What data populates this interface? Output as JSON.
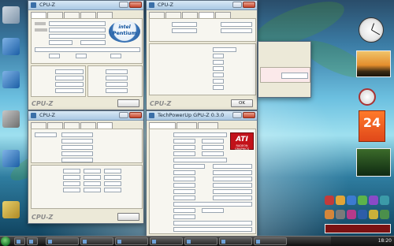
{
  "desktop": {
    "icons": [
      {
        "name": "computer-icon"
      },
      {
        "name": "recycle-bin-icon"
      },
      {
        "name": "internet-explorer-icon"
      },
      {
        "name": "network-icon"
      },
      {
        "name": "control-panel-icon"
      },
      {
        "name": "folder-icon"
      }
    ]
  },
  "windows": {
    "cpuz_cpu": {
      "title": "CPU-Z",
      "logo": "CPU-Z",
      "brand_top": "intel",
      "brand_bottom": "Pentium"
    },
    "cpuz_memory": {
      "title": "CPU-Z",
      "logo": "CPU-Z",
      "ok": "OK"
    },
    "cpuz_spd": {
      "title": "CPU-Z",
      "logo": "CPU-Z"
    },
    "gpuz": {
      "title": "TechPowerUp GPU-Z 0.3.0",
      "brand": "ATI",
      "brand_sub": "RADEON GRAPHICS"
    }
  },
  "gadgets": {
    "calendar_day": "24",
    "icons": [
      "clock-gadget",
      "slideshow-gadget",
      "calendar-gadget",
      "cpu-meter-gadget"
    ]
  },
  "taskbar": {
    "tray_time": "18:20"
  },
  "colors": {
    "window_bg": "#ece9d8",
    "title_gradient_top": "#d9e8f5",
    "ati_red": "#c2121a",
    "calendar_orange": "#ff7a2a"
  }
}
